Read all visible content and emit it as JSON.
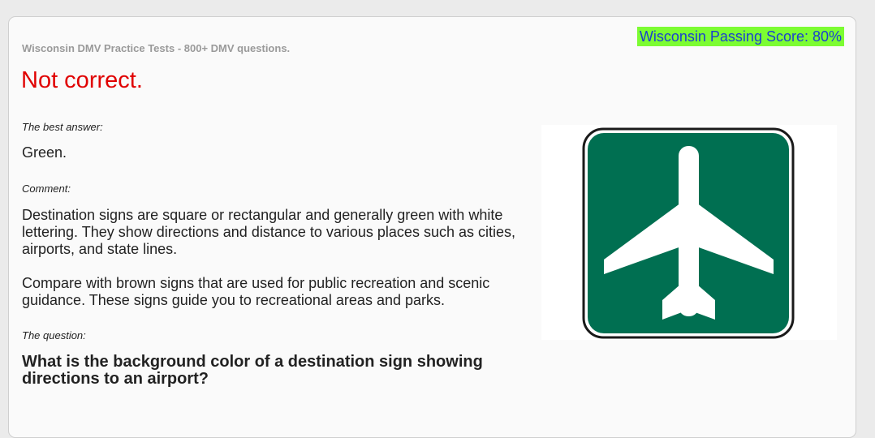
{
  "header": {
    "site_title": "Wisconsin DMV Practice Tests - 800+ DMV questions.",
    "passing_score": "Wisconsin Passing Score: 80%"
  },
  "result": {
    "text": "Not correct.",
    "color": "#e00000"
  },
  "best_answer": {
    "label": "The best answer:",
    "text": "Green."
  },
  "comment": {
    "label": "Comment:",
    "paragraphs": [
      "Destination signs are square or rectangular and generally green with white lettering. They show directions and distance to various places such as cities, airports, and state lines.",
      "Compare with brown signs that are used for public recreation and scenic guidance. These signs guide you to recreational areas and parks."
    ]
  },
  "question": {
    "label": "The question:",
    "text": "What is the background color of a destination sign showing directions to an airport?"
  },
  "sign_image": {
    "icon": "airport-sign-icon",
    "background_color": "#006f51",
    "symbol_color": "#ffffff"
  },
  "colors": {
    "badge_background": "#7cfc32",
    "badge_text": "#1a3fd0"
  }
}
